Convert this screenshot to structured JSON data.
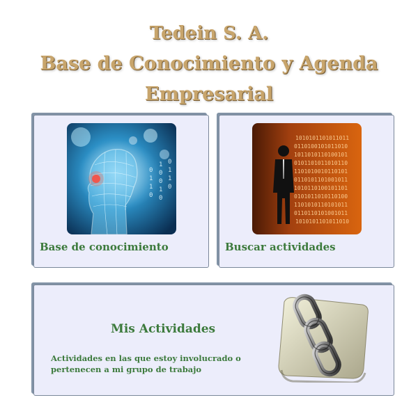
{
  "header": {
    "company": "Tedein S. A.",
    "subtitle": "Base de Conocimiento y Agenda Empresarial"
  },
  "cards": {
    "knowledge_base": {
      "label": "Base de conocimiento",
      "icon": "digital-head-icon"
    },
    "search_activities": {
      "label": "Buscar actividades",
      "icon": "binary-businessman-icon"
    },
    "my_activities": {
      "title": "Mis Actividades",
      "description": "Actividades en las que estoy involucrado o pertenecen a mi grupo de trabajo",
      "icon": "chain-link-icon"
    }
  },
  "colors": {
    "title_gold": "#c8a56c",
    "label_green": "#3c7a3c",
    "card_bg": "#ecedfb",
    "card_border": "#8293a6"
  }
}
